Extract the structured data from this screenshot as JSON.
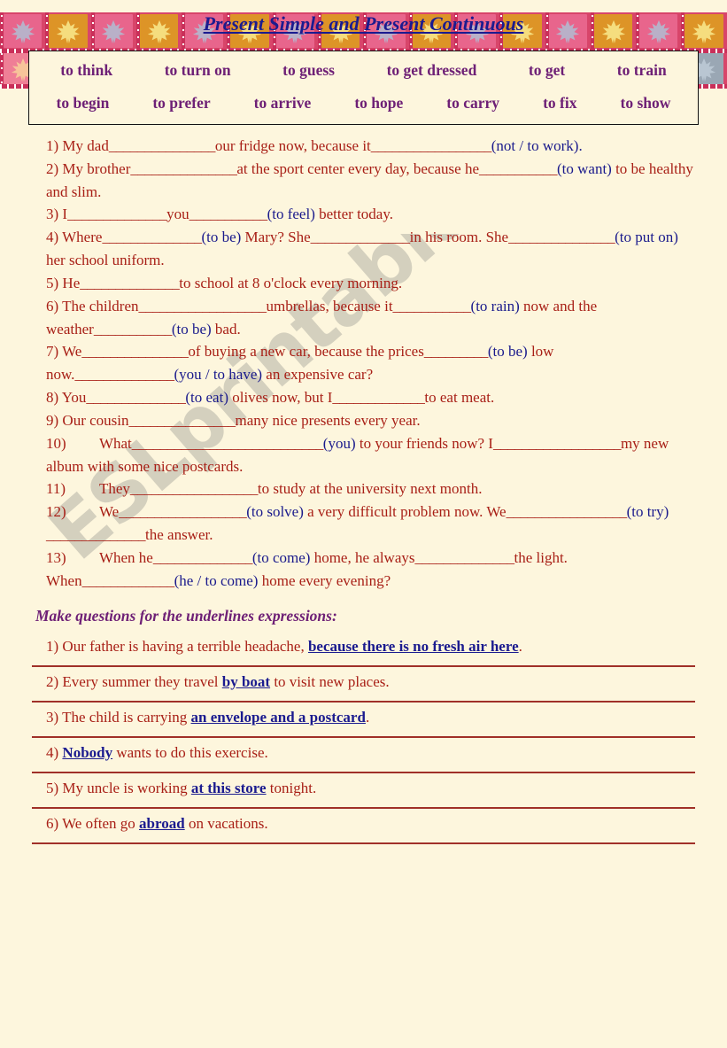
{
  "title": "Present Simple and Present Continuous",
  "word_bank": {
    "row1": [
      "to think",
      "to turn on",
      "to guess",
      "to get dressed",
      "to get",
      "to train"
    ],
    "row2": [
      "to begin",
      "to prefer",
      "to arrive",
      "to hope",
      "to carry",
      "to fix",
      "to show"
    ]
  },
  "exercises": {
    "items": [
      {
        "number": "1)",
        "segments": [
          {
            "t": "text",
            "v": "My dad"
          },
          {
            "t": "blank",
            "v": "_______________"
          },
          {
            "t": "text",
            "v": "our fridge now, because it"
          },
          {
            "t": "blank",
            "v": "_________________"
          },
          {
            "t": "hint",
            "v": "(not / to work)."
          }
        ]
      },
      {
        "number": "2)",
        "segments": [
          {
            "t": "text",
            "v": "My brother"
          },
          {
            "t": "blank",
            "v": "_______________"
          },
          {
            "t": "text",
            "v": "at the sport center every day, because he"
          },
          {
            "t": "blank",
            "v": "___________"
          },
          {
            "t": "hint",
            "v": "(to want)"
          },
          {
            "t": "text",
            "v": "to be healthy and slim."
          }
        ]
      },
      {
        "number": "3)",
        "segments": [
          {
            "t": "text",
            "v": "I"
          },
          {
            "t": "blank",
            "v": "______________"
          },
          {
            "t": "text",
            "v": "you"
          },
          {
            "t": "blank",
            "v": "___________"
          },
          {
            "t": "hint",
            "v": "(to feel)"
          },
          {
            "t": "text",
            "v": "better today."
          }
        ]
      },
      {
        "number": "4)",
        "segments": [
          {
            "t": "text",
            "v": "Where"
          },
          {
            "t": "blank",
            "v": "______________"
          },
          {
            "t": "hint",
            "v": "(to be)"
          },
          {
            "t": "text",
            "v": "Mary? She"
          },
          {
            "t": "blank",
            "v": "______________"
          },
          {
            "t": "text",
            "v": "in his room. She"
          },
          {
            "t": "blank",
            "v": "_______________"
          },
          {
            "t": "hint",
            "v": "(to put on)"
          },
          {
            "t": "text",
            "v": "her school uniform."
          }
        ]
      },
      {
        "number": "5)",
        "segments": [
          {
            "t": "text",
            "v": "He"
          },
          {
            "t": "blank",
            "v": "______________"
          },
          {
            "t": "text",
            "v": "to school at 8 o'clock every morning."
          }
        ]
      },
      {
        "number": "6)",
        "segments": [
          {
            "t": "text",
            "v": "The children"
          },
          {
            "t": "blank",
            "v": "__________________"
          },
          {
            "t": "text",
            "v": "umbrellas, because it"
          },
          {
            "t": "blank",
            "v": "___________"
          },
          {
            "t": "hint",
            "v": "(to rain)"
          },
          {
            "t": "text",
            "v": "now and the weather"
          },
          {
            "t": "blank",
            "v": "___________"
          },
          {
            "t": "hint",
            "v": "(to be)"
          },
          {
            "t": "text",
            "v": "bad."
          }
        ]
      },
      {
        "number": "7)",
        "segments": [
          {
            "t": "text",
            "v": "We"
          },
          {
            "t": "blank",
            "v": "_______________"
          },
          {
            "t": "text",
            "v": "of buying a new car, because the prices"
          },
          {
            "t": "blank",
            "v": "_________"
          },
          {
            "t": "hint",
            "v": "(to be)"
          },
          {
            "t": "text",
            "v": "low now."
          },
          {
            "t": "blank",
            "v": "______________"
          },
          {
            "t": "hint",
            "v": "(you / to have)"
          },
          {
            "t": "text",
            "v": "an expensive car?"
          }
        ]
      },
      {
        "number": "8)",
        "segments": [
          {
            "t": "text",
            "v": "You"
          },
          {
            "t": "blank",
            "v": "______________"
          },
          {
            "t": "hint",
            "v": "(to eat)"
          },
          {
            "t": "text",
            "v": "olives now, but I"
          },
          {
            "t": "blank",
            "v": "_____________"
          },
          {
            "t": "text",
            "v": "to eat meat."
          }
        ]
      },
      {
        "number": "9)",
        "segments": [
          {
            "t": "text",
            "v": "Our cousin"
          },
          {
            "t": "blank",
            "v": "_______________"
          },
          {
            "t": "text",
            "v": "many nice presents every year."
          }
        ]
      },
      {
        "number": "10)",
        "wide": true,
        "segments": [
          {
            "t": "text",
            "v": "What"
          },
          {
            "t": "blank",
            "v": "___________________________"
          },
          {
            "t": "hint",
            "v": "(you)"
          },
          {
            "t": "text",
            "v": "to your friends now? I"
          },
          {
            "t": "blank",
            "v": "__________________"
          },
          {
            "t": "text",
            "v": "my new album with some nice postcards."
          }
        ]
      },
      {
        "number": "11)",
        "wide": true,
        "segments": [
          {
            "t": "text",
            "v": "They"
          },
          {
            "t": "blank",
            "v": "__________________"
          },
          {
            "t": "text",
            "v": "to study at the university next month."
          }
        ]
      },
      {
        "number": "12)",
        "wide": true,
        "segments": [
          {
            "t": "text",
            "v": "We"
          },
          {
            "t": "blank",
            "v": "__________________"
          },
          {
            "t": "hint",
            "v": "(to solve)"
          },
          {
            "t": "text",
            "v": "a very difficult problem now. We"
          },
          {
            "t": "blank",
            "v": "_________________"
          },
          {
            "t": "hint",
            "v": "(to try)"
          },
          {
            "t": "blank",
            "v": "______________"
          },
          {
            "t": "text",
            "v": "the answer."
          }
        ]
      },
      {
        "number": "13)",
        "wide": true,
        "segments": [
          {
            "t": "text",
            "v": "When he"
          },
          {
            "t": "blank",
            "v": "______________"
          },
          {
            "t": "hint",
            "v": "(to come)"
          },
          {
            "t": "text",
            "v": "home, he always"
          },
          {
            "t": "blank",
            "v": "______________"
          },
          {
            "t": "text",
            "v": "the light. When"
          },
          {
            "t": "blank",
            "v": "_____________"
          },
          {
            "t": "hint",
            "v": "(he / to come)"
          },
          {
            "t": "text",
            "v": "home every evening?"
          }
        ]
      }
    ]
  },
  "section2": {
    "heading": "Make questions for the underlines expressions:",
    "questions": [
      {
        "number": "1)",
        "before": "Our father is having a terrible headache, ",
        "underlined": "because there is no fresh air here",
        "after": "."
      },
      {
        "number": "2)",
        "before": "Every summer they travel ",
        "underlined": "by boat",
        "after": " to visit new places."
      },
      {
        "number": "3)",
        "before": "The child is carrying ",
        "underlined": "an envelope and a postcard",
        "after": "."
      },
      {
        "number": "4)",
        "before": "",
        "underlined": "Nobody",
        "after": " wants to do this exercise."
      },
      {
        "number": "5)",
        "before": "My uncle is working ",
        "underlined": "at this store",
        "after": " tonight."
      },
      {
        "number": "6)",
        "before": "We often go ",
        "underlined": "abroad",
        "after": " on vacations."
      }
    ]
  },
  "watermark": {
    "text": "ESLprintables.com"
  },
  "colors": {
    "page_background": "#fdf6dd",
    "title": "#1b1b8f",
    "body_text": "#a81f16",
    "hint_text": "#1a1a8c",
    "wordbank_text": "#6e2076",
    "answer_line": "#a03028",
    "border_pink": "#d8456a"
  }
}
